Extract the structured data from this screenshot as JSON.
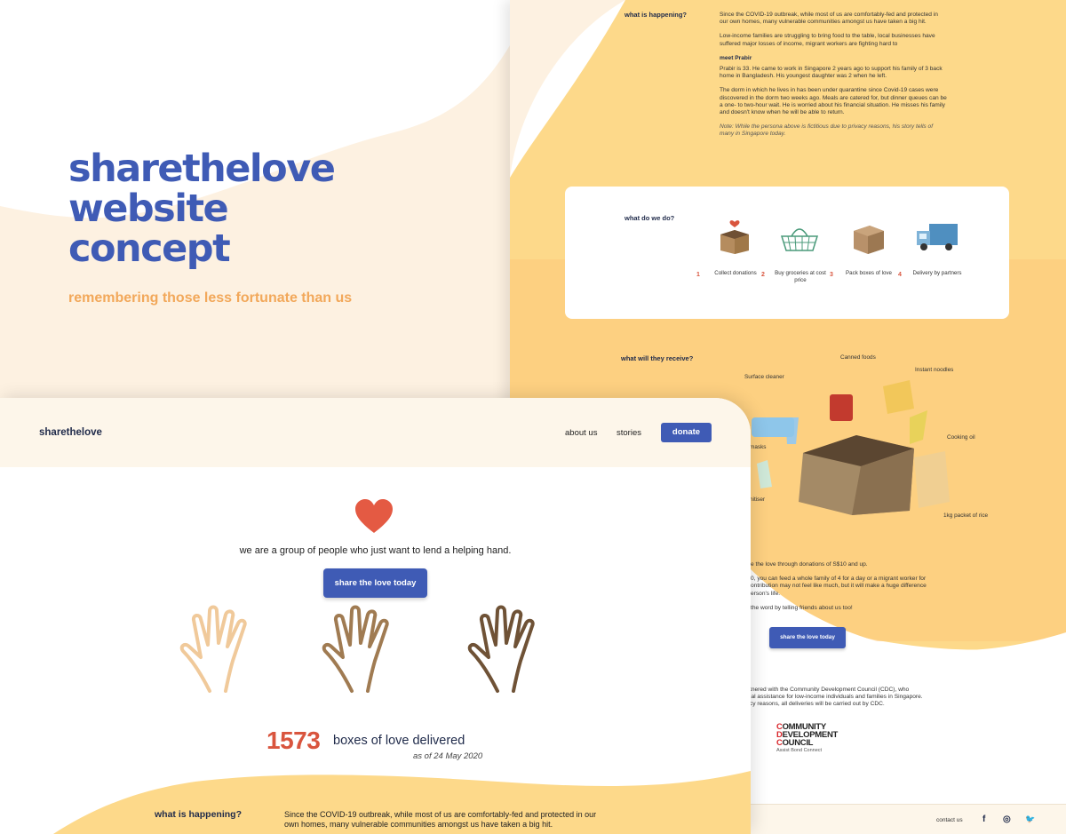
{
  "hero": {
    "title_lines": [
      "sharethelove",
      "website",
      "concept"
    ],
    "subtitle": "remembering those less fortunate than us"
  },
  "right_page": {
    "happening": {
      "label": "what is happening?",
      "p1": "Since the COVID-19 outbreak, while most of us are comfortably-fed and protected in our own homes, many vulnerable communities amongst us have taken a big hit.",
      "p2": "Low-income families are struggling to bring food to the table, local businesses have suffered major losses of income, migrant workers are fighting hard to",
      "meet_label": "meet Prabir",
      "p3": "Prabir is 33. He came to work in Singapore 2 years ago to support his family of 3 back home in Bangladesh. His youngest daughter was 2 when he left.",
      "p4": "The dorm in which he lives in has been under quarantine since Covid-19 cases were discovered in the dorm two weeks ago. Meals are catered for, but dinner queues can be a one- to two-hour wait. He is worried about his financial situation. He misses his family and doesn't know when he will be able to return.",
      "note": "Note: While the persona above is fictitious due to privacy reasons, his story tells of many in Singapore today."
    },
    "what_we_do": {
      "label": "what do we do?",
      "steps": [
        {
          "num": "1",
          "label": "Collect donations",
          "icon": "box-heart-icon"
        },
        {
          "num": "2",
          "label": "Buy groceries at cost price",
          "icon": "basket-icon"
        },
        {
          "num": "3",
          "label": "Pack boxes of love",
          "icon": "box-icon"
        },
        {
          "num": "4",
          "label": "Delivery by partners",
          "icon": "truck-icon"
        }
      ]
    },
    "receive": {
      "label": "what will they receive?",
      "items": [
        "Surface cleaner",
        "Canned foods",
        "Instant noodles",
        "masks",
        "Cooking oil",
        "nitiser",
        "1kg packet of rice"
      ]
    },
    "donate": {
      "line1": "e the love through donations of S$10 and up.",
      "line2": "0, you can feed a whole family of 4 for a day or a migrant worker for",
      "line3": "ontribution may not feel like much, but it will make a huge difference",
      "line4": "erson's life.",
      "line5": "the word by telling friends about us too!",
      "button": "share the love today"
    },
    "partner": {
      "line1": "tnered with the Community Development Council (CDC), who",
      "line2": "ial assistance for low-income individuals and families in Singapore.",
      "line3": "cy reasons, all deliveries will be carried out by CDC.",
      "logo_l1": "OMMUNITY",
      "logo_l2": "EVELOPMENT",
      "logo_l3": "OUNCIL",
      "logo_tag": "Assist Bond Connect"
    },
    "footer": {
      "contact": "contact us",
      "facebook": "f",
      "instagram": "◎",
      "twitter": "🐦"
    }
  },
  "left_page": {
    "nav": {
      "logo": "sharethelove",
      "about": "about us",
      "stories": "stories",
      "donate": "donate"
    },
    "tagline": "we are a group of people who just want to lend a helping hand.",
    "cta": "share the love today",
    "count": "1573",
    "count_label": "boxes of love delivered",
    "count_date": "as of 24 May 2020",
    "happening_label": "what is happening?",
    "happening_text": "Since the COVID-19 outbreak, while most of us are comfortably-fed and protected in our own homes, many vulnerable communities amongst us have taken a big hit."
  },
  "colors": {
    "brand_blue": "#3f5bb5",
    "accent_orange": "#f2a85a",
    "accent_red": "#d9553e",
    "cream": "#fdf1e1",
    "yellow": "#fdd98a"
  }
}
